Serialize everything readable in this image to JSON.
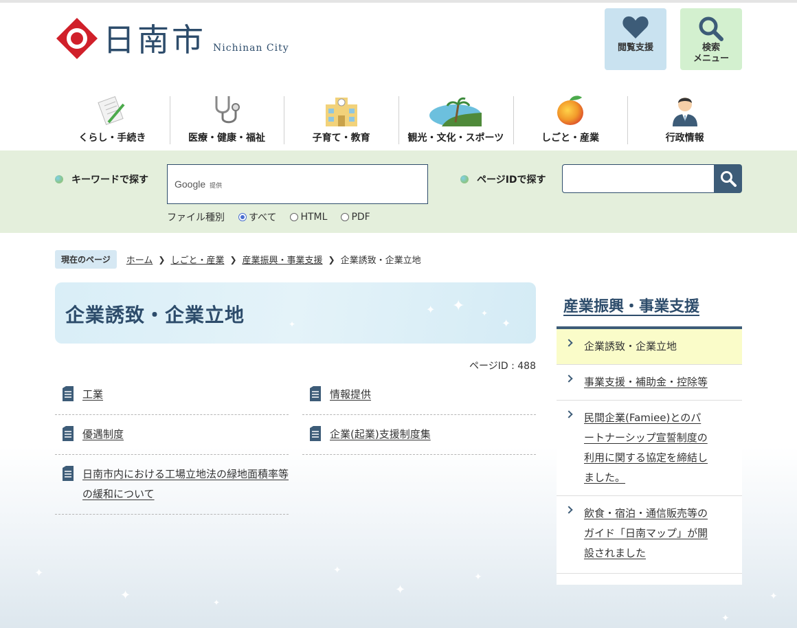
{
  "header": {
    "logo_text": "日南市",
    "logo_sub": "Nichinan City",
    "reading_support": "閲覧支援",
    "search_menu": "検索\nメニュー"
  },
  "gnav": [
    {
      "label": "くらし・手続き",
      "icon": "notepad-pencil-icon"
    },
    {
      "label": "医療・健康・福祉",
      "icon": "stethoscope-icon"
    },
    {
      "label": "子育て・教育",
      "icon": "school-building-icon"
    },
    {
      "label": "観光・文化・スポーツ",
      "icon": "palm-coast-icon"
    },
    {
      "label": "しごと・産業",
      "icon": "mango-icon"
    },
    {
      "label": "行政情報",
      "icon": "official-person-icon"
    }
  ],
  "search": {
    "keyword_label": "キーワードで探す",
    "google_label": "Google",
    "google_sub": "提供",
    "filetype_label": "ファイル種別",
    "options": [
      "すべて",
      "HTML",
      "PDF"
    ],
    "selected": "すべて",
    "pageid_label": "ページIDで探す"
  },
  "breadcrumb": {
    "tag": "現在のページ",
    "items": [
      "ホーム",
      "しごと・産業",
      "産業振興・事業支援"
    ],
    "current": "企業誘致・企業立地"
  },
  "page": {
    "title": "企業誘致・企業立地",
    "page_id": "ページID : 488"
  },
  "links": [
    "工業",
    "情報提供",
    "優遇制度",
    "企業(起業)支援制度集",
    "日南市内における工場立地法の緑地面積率等の緩和について"
  ],
  "sidebar": {
    "title": "産業振興・事業支援",
    "items": [
      "企業誘致・企業立地",
      "事業支援・補助金・控除等",
      "民間企業(Famiee)とのパートナーシップ宣誓制度の利用に関する協定を締結しました。",
      "飲食・宿泊・通信販売等のガイド「日南マップ」が開設されました"
    ]
  },
  "colors": {
    "brand_navy": "#2d4c6b",
    "logo_red": "#d0202a",
    "search_band": "#e4efdc",
    "active_side": "#fafcc9"
  }
}
